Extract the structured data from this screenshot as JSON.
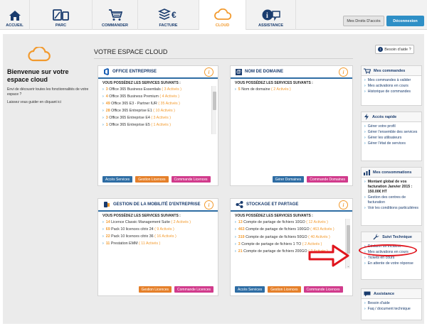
{
  "nav": {
    "items": [
      {
        "label": "ACCUEIL",
        "icon": "home-icon"
      },
      {
        "label": "PARC",
        "icon": "devices-icon"
      },
      {
        "label": "COMMANDER",
        "icon": "cart-icon"
      },
      {
        "label": "FACTURE",
        "icon": "euro-layers-icon"
      },
      {
        "label": "CLOUD",
        "icon": "cloud-icon"
      },
      {
        "label": "ASSISTANCE",
        "icon": "info-bubble-icon"
      }
    ],
    "active": "CLOUD",
    "rights_button": "Mes Droits D'accès",
    "logout_button": "Déconnexion"
  },
  "welcome": {
    "title": "Bienvenue sur votre espace cloud",
    "text1": "Envi de découvrir toutes les fonctionnalités de votre espace ?",
    "text2": "Laissez vous guider en cliquant ici"
  },
  "page_title": "VOTRE ESPACE CLOUD",
  "help_label": "Besoin d'aide ?",
  "cards": {
    "office": {
      "title": "OFFICE ENTREPRISE",
      "subtitle": "VOUS POSSÉDEZ LES SERVICES SUIVANTS :",
      "items": [
        {
          "num": "3",
          "name": "Office 365 Business Essentials",
          "active": "( 3 Activés )"
        },
        {
          "num": "4",
          "name": "Office 365 Business Premium",
          "active": "( 4 Activés )"
        },
        {
          "num": "49",
          "name": "Office 365 E3 - Partner IUR",
          "active": "( 35 Activés )"
        },
        {
          "num": "28",
          "name": "Office 365 Entreprise E1",
          "active": "( 10 Activés )"
        },
        {
          "num": "3",
          "name": "Office 365 Entreprise E4",
          "active": "( 3 Activés )"
        },
        {
          "num": "1",
          "name": "Office 365 Entreprise E5",
          "active": "( 1 Activés )"
        }
      ],
      "buttons": [
        "Accès Services",
        "Gestion Licences",
        "Commande Licences"
      ]
    },
    "domain": {
      "title": "NOM DE DOMAINE",
      "subtitle": "VOUS POSSÉDEZ LES SERVICES SUIVANTS :",
      "items": [
        {
          "num": "5",
          "name": "Nom de domaine",
          "active": "( 2 Activés )"
        }
      ],
      "buttons": [
        "Gérer Domaines",
        "Commande Domaines"
      ]
    },
    "mobility": {
      "title": "GESTION DE LA MOBILITÉ D'ENTREPRISE",
      "subtitle": "VOUS POSSÉDEZ LES SERVICES SUIVANTS :",
      "items": [
        {
          "num": "14",
          "name": "Licence Classic Management Suite",
          "active": "( 2 Activés )"
        },
        {
          "num": "69",
          "name": "Pack 10 licences citrix 24",
          "active": "( 9 Activés )"
        },
        {
          "num": "22",
          "name": "Pack 10 licences citrix 36",
          "active": "( 16 Activés )"
        },
        {
          "num": "11",
          "name": "Prestation EMM",
          "active": "( 11 Activés )"
        }
      ],
      "buttons": [
        "Gestion Licences",
        "Commande Licences"
      ]
    },
    "storage": {
      "title": "STOCKAGE ET PARTAGE",
      "subtitle": "VOUS POSSÉDEZ LES SERVICES SUIVANTS :",
      "items": [
        {
          "num": "13",
          "name": "Compte de partage de fichiers 10GO",
          "active": "( 12",
          "active2": "Activés )"
        },
        {
          "num": "463",
          "name": "Compte de partage de fichiers 100GO",
          "active": "( 463",
          "active2": "Activés )"
        },
        {
          "num": "319",
          "name": "Compte de partage de fichiers 50GO",
          "active": "( 40 Activés )"
        },
        {
          "num": "3",
          "name": "Compte de partage de fichiers 1 TO",
          "active": "( 2 Activés )"
        },
        {
          "num": "21",
          "name": "Compte de partage de fichiers 200GO",
          "active": "( 2 Activés )"
        }
      ],
      "buttons": [
        "Accès Services",
        "Gestion Licences",
        "Commande Licences"
      ]
    }
  },
  "sidebar": {
    "orders": {
      "title": "Mes commandes",
      "items": [
        "Mes commandes à valider",
        "Mes activations en cours",
        "Historique de commandes"
      ]
    },
    "quick": {
      "title": "Accès rapide",
      "items": [
        "Gérer votre profil",
        "Gérer l'ensemble des services",
        "Gérer les utilisateurs",
        "Gérer l'état de services"
      ]
    },
    "consumption": {
      "title": "Mes consommations",
      "summary": "Montant global de vos facturation Janvier 2015 : 150.00€ HT",
      "items": [
        "Gestion des centres de facturation",
        "Voir les conditions particulières"
      ]
    },
    "tech": {
      "title": "Suivi Technique",
      "items": [
        "Déclarer un incident",
        "Mes activations en cours",
        "Tickets en cours",
        "En attente de votre réponse"
      ]
    },
    "assist": {
      "title": "Assistance",
      "items": [
        "Besoin d'aide",
        "Faq / document technique"
      ]
    }
  },
  "colors": {
    "navy": "#1a3c6e",
    "orange": "#f29a2e",
    "blue": "#2e8fc6",
    "red_annotation": "#e0141c"
  }
}
